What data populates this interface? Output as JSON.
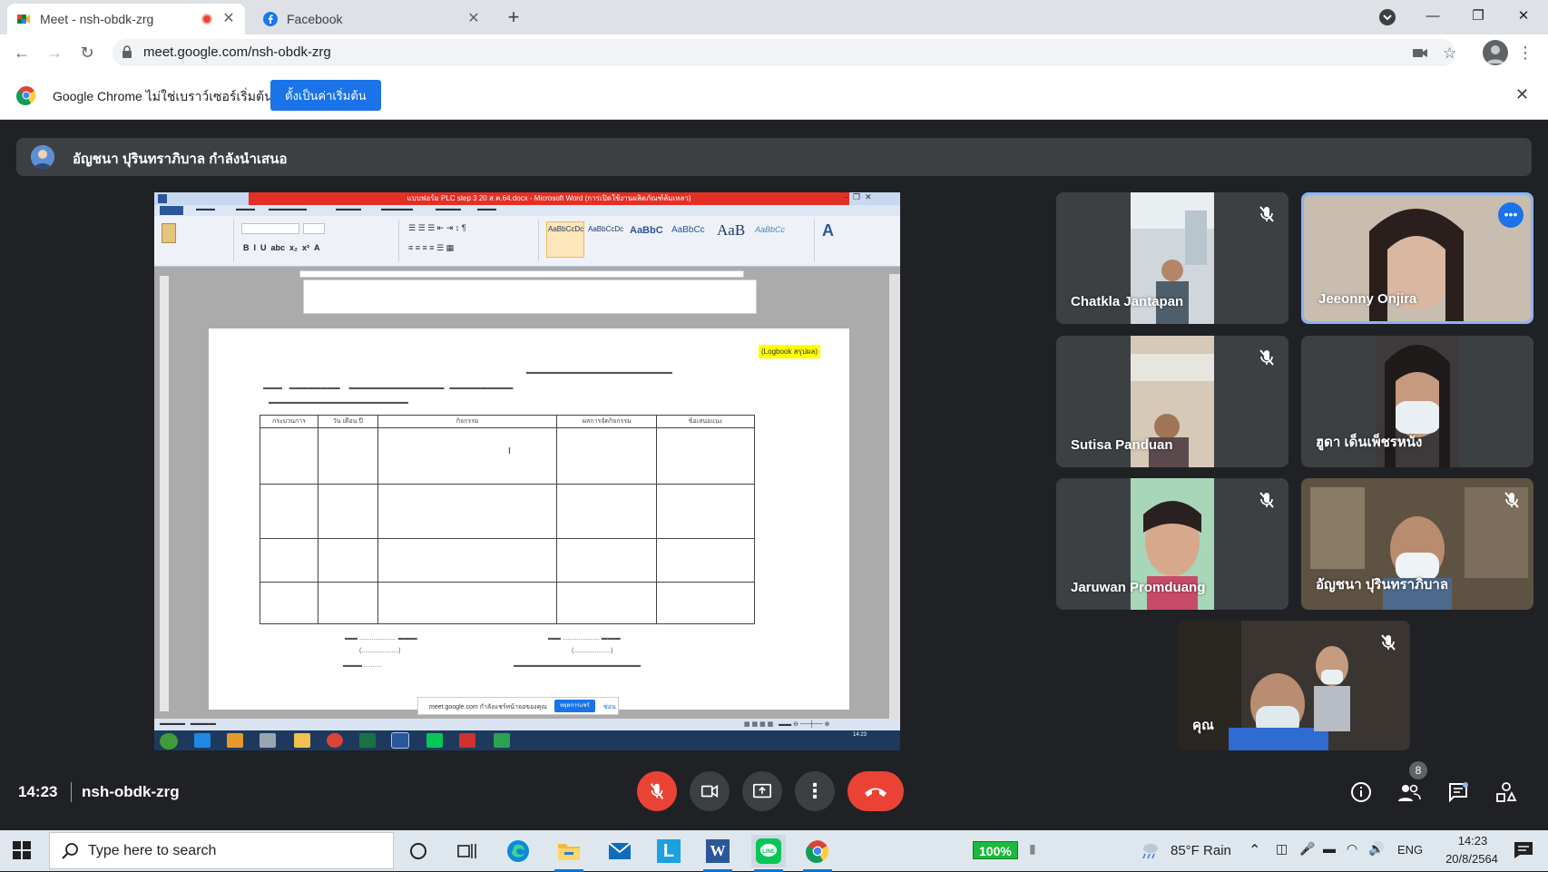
{
  "browser": {
    "tabs": [
      {
        "title": "Meet - nsh-obdk-zrg",
        "active": true
      },
      {
        "title": "Facebook",
        "active": false
      }
    ],
    "url": "meet.google.com/nsh-obdk-zrg",
    "infobar_message": "Google Chrome ไม่ใช่เบราว์เซอร์เริ่มต้น",
    "infobar_button": "ตั้งเป็นค่าเริ่มต้น"
  },
  "meet": {
    "presenter_text": "อัญชนา ปุรินทราภิบาล กำลังนำเสนอ",
    "shared_screen": {
      "window_title": "แบบฟอร์ม PLC step 3 20 ส.ค.64.docx - Microsoft Word (การเปิดใช้งานผลิตภัณฑ์ล้มเหลว)",
      "logbook_label": "(Logbook สรุปผล)",
      "table_headers": [
        "กระบวนการ",
        "วัน เดือน ปี",
        "กิจกรรม",
        "ผลการจัดกิจกรรม",
        "ข้อเสนอแนะ"
      ],
      "styles": [
        "AaBbCcDc",
        "AaBbCcDc",
        "AaBbC",
        "AaBbCc",
        "AaB",
        "AaBbCc"
      ],
      "banner_text": "meet.google.com กำลังแชร์หน้าจอของคุณ",
      "banner_button": "หยุดการแชร์",
      "banner_hide": "ซ่อน"
    },
    "participants": [
      {
        "name": "Chatkla Jantapan",
        "muted": true,
        "speaking": false
      },
      {
        "name": "Jeeonny Onjira",
        "muted": false,
        "speaking": true
      },
      {
        "name": "Sutisa Panduan",
        "muted": true,
        "speaking": false
      },
      {
        "name": "ฮูดา เด็นเพ็ชรหนัง",
        "muted": false,
        "speaking": false
      },
      {
        "name": "Jaruwan Promduang",
        "muted": true,
        "speaking": false
      },
      {
        "name": "อัญชนา ปุรินทราภิบาล",
        "muted": true,
        "speaking": false
      },
      {
        "name": "คุณ",
        "muted": true,
        "speaking": false
      }
    ],
    "time": "14:23",
    "meeting_code": "nsh-obdk-zrg",
    "people_count": "8"
  },
  "taskbar": {
    "search_placeholder": "Type here to search",
    "battery": "100%",
    "weather": "85°F  Rain",
    "language": "ENG",
    "clock_time": "14:23",
    "clock_date": "20/8/2564"
  },
  "colors": {
    "meet_bg": "#202124",
    "tile_bg": "#3c4043",
    "danger": "#ea4335",
    "accent": "#1a73e8",
    "speaking_border": "#8ab4f8"
  }
}
